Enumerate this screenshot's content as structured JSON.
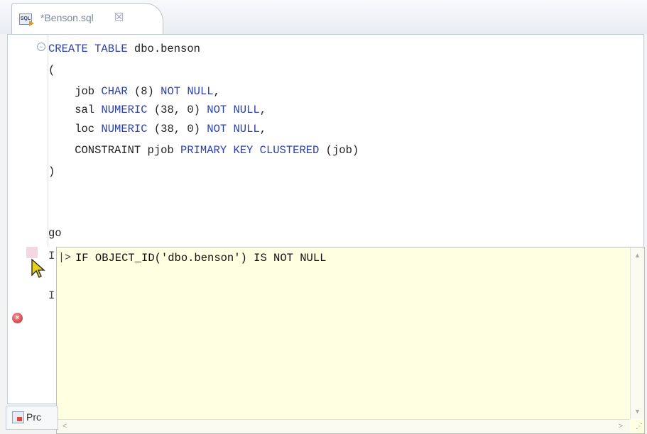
{
  "editor_tab": {
    "icon_text": "SQL",
    "title": "*Benson.sql",
    "close_glyph": "☒"
  },
  "code_lines": [
    {
      "parts": [
        {
          "t": "CREATE TABLE",
          "k": true
        },
        {
          "t": " dbo.benson",
          "k": false
        }
      ]
    },
    {
      "parts": [
        {
          "t": "(",
          "k": false
        }
      ]
    },
    {
      "parts": [
        {
          "t": "    job ",
          "k": false
        },
        {
          "t": "CHAR",
          "k": true
        },
        {
          "t": " (8) ",
          "k": false
        },
        {
          "t": "NOT NULL",
          "k": true
        },
        {
          "t": ",",
          "k": false
        }
      ]
    },
    {
      "parts": [
        {
          "t": "    sal ",
          "k": false
        },
        {
          "t": "NUMERIC",
          "k": true
        },
        {
          "t": " (38, 0) ",
          "k": false
        },
        {
          "t": "NOT NULL",
          "k": true
        },
        {
          "t": ",",
          "k": false
        }
      ]
    },
    {
      "parts": [
        {
          "t": "    loc ",
          "k": false
        },
        {
          "t": "NUMERIC",
          "k": true
        },
        {
          "t": " (38, 0) ",
          "k": false
        },
        {
          "t": "NOT NULL",
          "k": true
        },
        {
          "t": ",",
          "k": false
        }
      ]
    },
    {
      "parts": [
        {
          "t": "    CONSTRAINT pjob ",
          "k": false
        },
        {
          "t": "PRIMARY KEY CLUSTERED",
          "k": true
        },
        {
          "t": " (job)",
          "k": false
        }
      ]
    },
    {
      "parts": [
        {
          "t": ")",
          "k": false
        }
      ]
    },
    {
      "parts": [
        {
          "t": "",
          "k": false
        }
      ]
    },
    {
      "parts": [
        {
          "t": "go",
          "k": false
        }
      ]
    }
  ],
  "hidden_line_starts": [
    "I",
    "I"
  ],
  "content_assist": {
    "suggestion": "IF OBJECT_ID('dbo.benson') IS NOT NULL",
    "caret": "|>"
  },
  "bottom_view": {
    "label": "Prc"
  },
  "icons": {
    "fold": "collapse-icon",
    "error": "error-icon",
    "cursor": "mouse-pointer-icon"
  }
}
